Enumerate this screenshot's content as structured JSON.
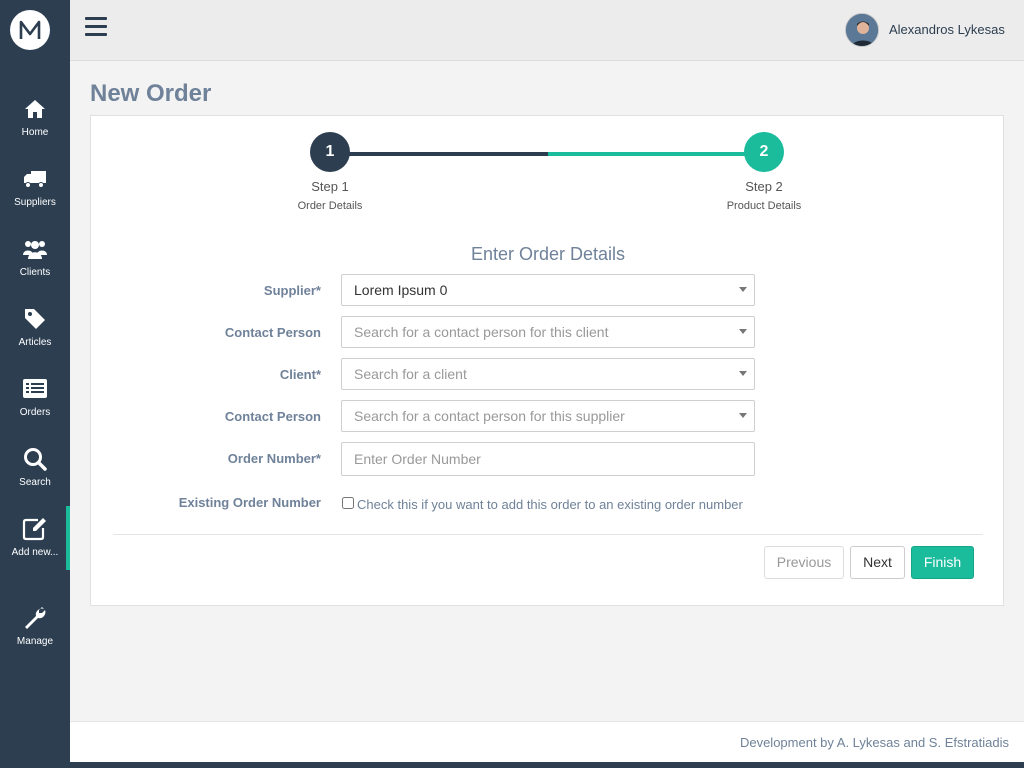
{
  "app": {
    "logo_letter": "M"
  },
  "sidebar": {
    "items": [
      {
        "label": "Home",
        "icon": "home-icon"
      },
      {
        "label": "Suppliers",
        "icon": "truck-icon"
      },
      {
        "label": "Clients",
        "icon": "users-icon"
      },
      {
        "label": "Articles",
        "icon": "tag-icon"
      },
      {
        "label": "Orders",
        "icon": "list-icon"
      },
      {
        "label": "Search",
        "icon": "search-icon"
      },
      {
        "label": "Add new...",
        "icon": "edit-icon",
        "active": true
      },
      {
        "label": "Manage",
        "icon": "wrench-icon"
      }
    ]
  },
  "header": {
    "user_name": "Alexandros Lykesas"
  },
  "page": {
    "title": "New Order"
  },
  "wizard": {
    "steps": [
      {
        "number": "1",
        "title": "Step 1",
        "subtitle": "Order Details"
      },
      {
        "number": "2",
        "title": "Step 2",
        "subtitle": "Product Details"
      }
    ]
  },
  "form": {
    "title": "Enter Order Details",
    "supplier": {
      "label": "Supplier*",
      "value": "Lorem Ipsum 0"
    },
    "contact_person_client": {
      "label": "Contact Person",
      "placeholder": "Search for a contact person for this client"
    },
    "client": {
      "label": "Client*",
      "placeholder": "Search for a client"
    },
    "contact_person_supplier": {
      "label": "Contact Person",
      "placeholder": "Search for a contact person for this supplier"
    },
    "order_number": {
      "label": "Order Number*",
      "placeholder": "Enter Order Number"
    },
    "existing_order": {
      "label": "Existing Order Number",
      "checkbox_label": "Check this if you want to add this order to an existing order number",
      "checked": false
    }
  },
  "buttons": {
    "previous": "Previous",
    "next": "Next",
    "finish": "Finish"
  },
  "footer": {
    "text": "Development by A. Lykesas and S. Efstratiadis"
  },
  "colors": {
    "sidebar": "#2c3e50",
    "accent": "#1abc9c",
    "label": "#6f8299"
  }
}
